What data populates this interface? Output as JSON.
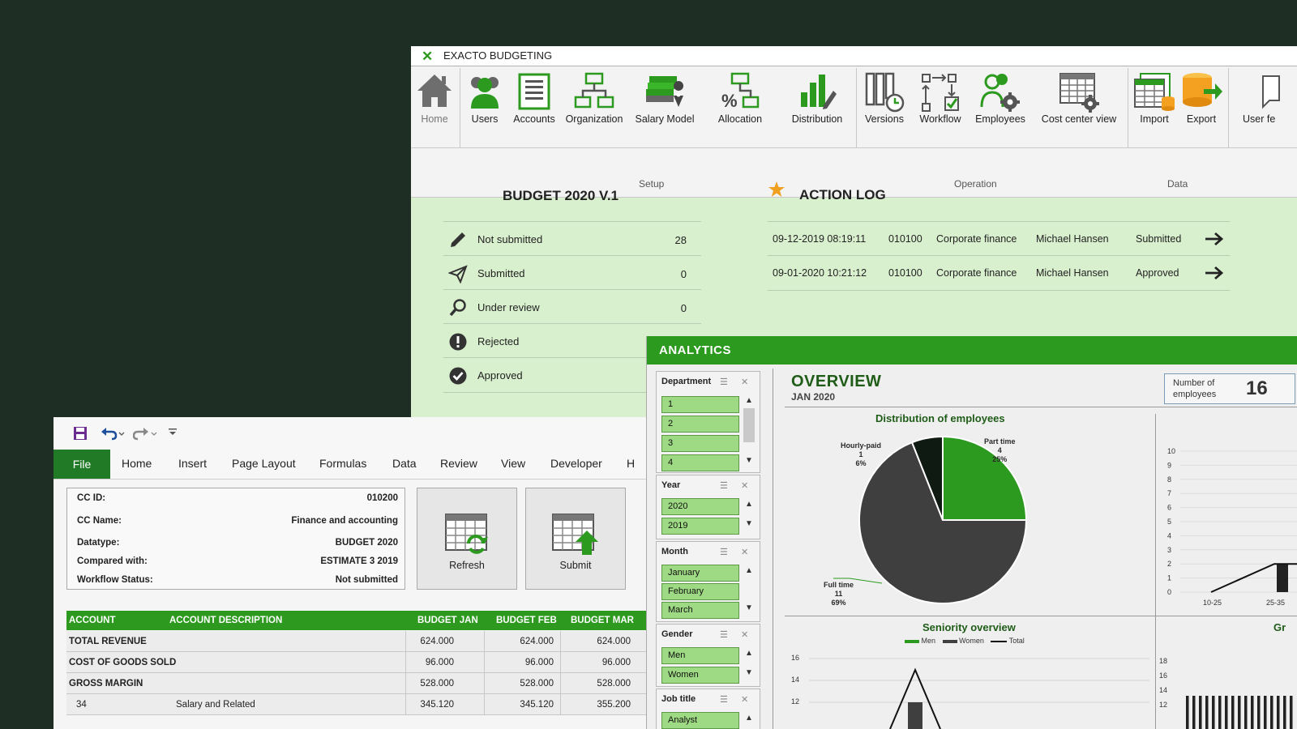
{
  "exacto": {
    "app_title": "EXACTO BUDGETING",
    "ribbon": {
      "buttons": [
        {
          "label": "Home",
          "icon": "home-icon"
        },
        {
          "label": "Users",
          "icon": "users-icon"
        },
        {
          "label": "Accounts",
          "icon": "accounts-icon"
        },
        {
          "label": "Organization",
          "icon": "organization-icon"
        },
        {
          "label": "Salary Model",
          "icon": "salary-model-icon"
        },
        {
          "label": "Allocation",
          "icon": "allocation-icon"
        },
        {
          "label": "Distribution",
          "icon": "distribution-icon"
        },
        {
          "label": "Versions",
          "icon": "versions-icon"
        },
        {
          "label": "Workflow",
          "icon": "workflow-icon"
        },
        {
          "label": "Employees",
          "icon": "employees-icon"
        },
        {
          "label": "Cost center view",
          "icon": "cost-center-view-icon"
        },
        {
          "label": "Import",
          "icon": "import-icon"
        },
        {
          "label": "Export",
          "icon": "export-icon"
        },
        {
          "label": "User fe",
          "icon": "user-feedback-icon"
        }
      ],
      "groups": {
        "setup": "Setup",
        "operation": "Operation",
        "data": "Data"
      }
    },
    "budget": {
      "title": "BUDGET 2020 V.1",
      "rows": [
        {
          "label": "Not submitted",
          "count": "28",
          "icon": "pencil-icon"
        },
        {
          "label": "Submitted",
          "count": "0",
          "icon": "paper-plane-icon"
        },
        {
          "label": "Under review",
          "count": "0",
          "icon": "magnifier-icon"
        },
        {
          "label": "Rejected",
          "count": "",
          "icon": "exclamation-icon"
        },
        {
          "label": "Approved",
          "count": "",
          "icon": "check-circle-icon"
        }
      ]
    },
    "action_log": {
      "title": "ACTION LOG",
      "rows": [
        {
          "timestamp": "09-12-2019 08:19:11",
          "cc": "010100",
          "department": "Corporate finance",
          "user": "Michael Hansen",
          "status": "Submitted"
        },
        {
          "timestamp": "09-01-2020 10:21:12",
          "cc": "010100",
          "department": "Corporate finance",
          "user": "Michael Hansen",
          "status": "Approved"
        }
      ]
    }
  },
  "excel": {
    "menu": [
      "File",
      "Home",
      "Insert",
      "Page Layout",
      "Formulas",
      "Data",
      "Review",
      "View",
      "Developer",
      "H"
    ],
    "info": [
      {
        "key": "CC ID:",
        "value": "010200"
      },
      {
        "key": "CC Name:",
        "value": "Finance and accounting"
      },
      {
        "key": "Datatype:",
        "value": "BUDGET 2020"
      },
      {
        "key": "Compared with:",
        "value": "ESTIMATE 3 2019"
      },
      {
        "key": "Workflow Status:",
        "value": "Not submitted"
      }
    ],
    "buttons": {
      "refresh": "Refresh",
      "submit": "Submit"
    },
    "table": {
      "headers": [
        "ACCOUNT",
        "ACCOUNT DESCRIPTION",
        "BUDGET JAN",
        "BUDGET FEB",
        "BUDGET MAR"
      ],
      "rows": [
        {
          "account": "TOTAL REVENUE",
          "desc": "",
          "jan": "624.000",
          "feb": "624.000",
          "mar": "624.000"
        },
        {
          "account": "COST OF GOODS SOLD",
          "desc": "",
          "jan": "96.000",
          "feb": "96.000",
          "mar": "96.000"
        },
        {
          "account": "GROSS MARGIN",
          "desc": "",
          "jan": "528.000",
          "feb": "528.000",
          "mar": "528.000"
        },
        {
          "account": "34",
          "desc": "Salary and Related",
          "jan": "345.120",
          "feb": "345.120",
          "mar": "355.200"
        }
      ]
    }
  },
  "analytics": {
    "header": "ANALYTICS",
    "slicers": [
      {
        "title": "Department",
        "items": [
          "1",
          "2",
          "3",
          "4"
        ]
      },
      {
        "title": "Year",
        "items": [
          "2020",
          "2019"
        ]
      },
      {
        "title": "Month",
        "items": [
          "January",
          "February",
          "March"
        ]
      },
      {
        "title": "Gender",
        "items": [
          "Men",
          "Women"
        ]
      },
      {
        "title": "Job title",
        "items": [
          "Analyst"
        ]
      }
    ],
    "overview": {
      "title": "OVERVIEW",
      "subtitle": "JAN 2020",
      "employees_label": "Number of employees",
      "employees_value": "16"
    },
    "colors": {
      "green": "#2c9a1e",
      "dark": "#3f3f3f",
      "black": "#0f1a12"
    }
  },
  "chart_data": [
    {
      "type": "pie",
      "title": "Distribution of employees",
      "slices": [
        {
          "label": "Part time",
          "count": "4",
          "percent": "25%",
          "value": 25,
          "color": "#2c9a1e"
        },
        {
          "label": "Full time",
          "count": "11",
          "percent": "69%",
          "value": 69,
          "color": "#3f3f3f"
        },
        {
          "label": "Hourly-paid",
          "count": "1",
          "percent": "6%",
          "value": 6,
          "color": "#0f1a12"
        }
      ]
    },
    {
      "type": "bar",
      "title": "",
      "y_ticks": [
        "0",
        "1",
        "2",
        "3",
        "4",
        "5",
        "6",
        "7",
        "8",
        "9",
        "10"
      ],
      "ylim": [
        0,
        10
      ],
      "categories": [
        "10-25",
        "25-35"
      ],
      "line_values": [
        0,
        2
      ],
      "bar_values": [
        0,
        2
      ]
    },
    {
      "type": "line",
      "title": "Seniority overview",
      "legend": [
        "Men",
        "Women",
        "Total"
      ],
      "y_ticks": [
        "12",
        "14",
        "16"
      ]
    },
    {
      "type": "bar",
      "title": "Gr",
      "y_ticks": [
        "12",
        "14",
        "16",
        "18"
      ]
    }
  ]
}
